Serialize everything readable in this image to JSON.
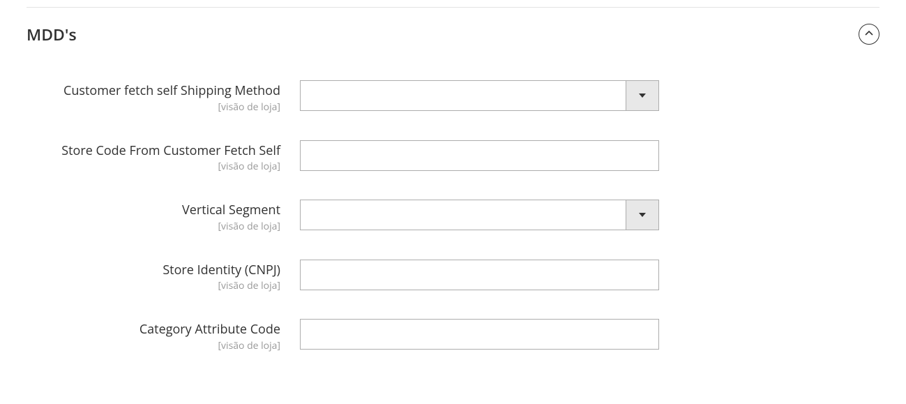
{
  "section": {
    "title": "MDD's",
    "scope_label": "[visão de loja]",
    "fields": {
      "shipping_method": {
        "label": "Customer fetch self Shipping Method",
        "value": ""
      },
      "store_code": {
        "label": "Store Code From Customer Fetch Self",
        "value": ""
      },
      "vertical": {
        "label": "Vertical Segment",
        "value": ""
      },
      "cnpj": {
        "label": "Store Identity (CNPJ)",
        "value": ""
      },
      "category_attr": {
        "label": "Category Attribute Code",
        "value": ""
      }
    }
  }
}
